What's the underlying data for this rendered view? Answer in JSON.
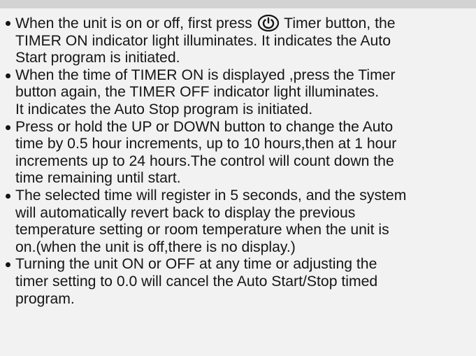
{
  "instructions": [
    {
      "lines": [
        {
          "before_icon": "When the unit is on or off, first press ",
          "icon": "timer-icon",
          "after_icon": " Timer button, the"
        },
        "TIMER ON indicator light illuminates. It indicates the Auto",
        "Start program is initiated."
      ]
    },
    {
      "lines": [
        "When the time of TIMER ON is displayed ,press the Timer",
        "button again, the TIMER OFF indicator light illuminates.",
        "It indicates the Auto Stop program is initiated."
      ]
    },
    {
      "lines": [
        "Press or hold the UP or DOWN button to change the Auto",
        "time by 0.5 hour increments, up to 10 hours,then at 1 hour",
        "increments up to 24 hours.The control will count down the",
        "time remaining until start."
      ]
    },
    {
      "lines": [
        "The selected time will register in 5 seconds, and the system",
        "will automatically revert back to display the previous",
        "temperature setting or room temperature when the unit is",
        "on.(when the unit is off,there is no display.)"
      ]
    },
    {
      "lines": [
        "Turning the unit ON or OFF at any time or adjusting the",
        "timer setting to 0.0 will cancel the Auto Start/Stop timed",
        "program."
      ]
    }
  ]
}
